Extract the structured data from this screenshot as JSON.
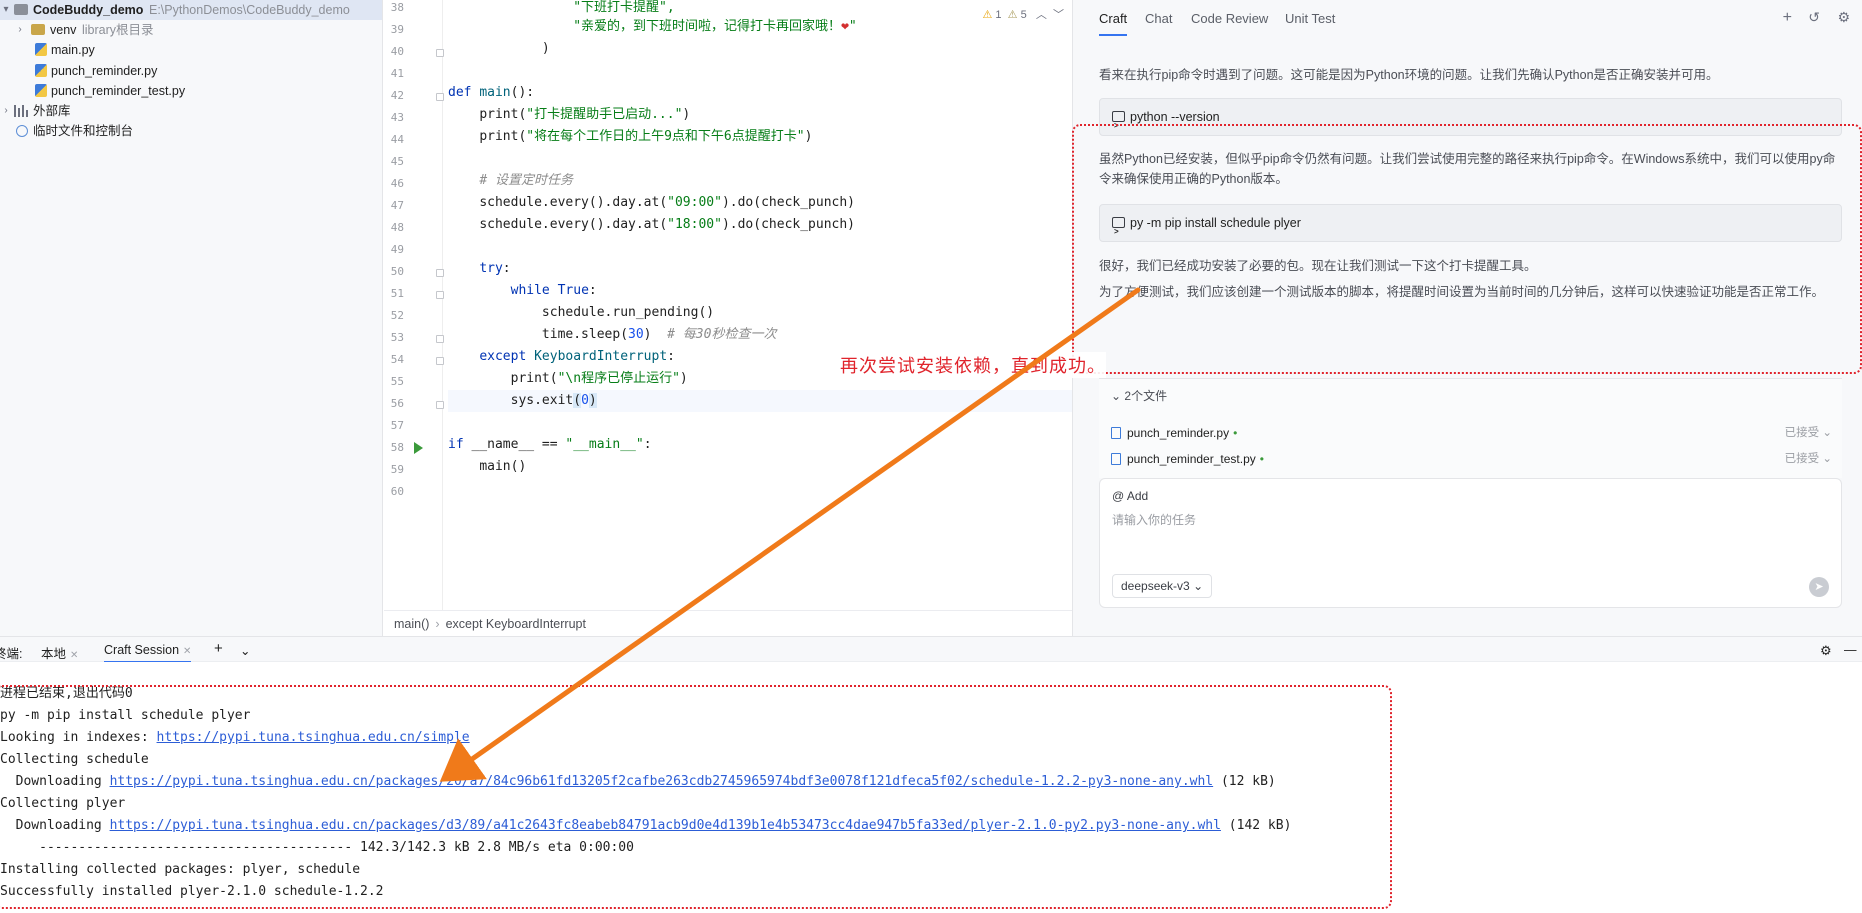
{
  "project_tree": {
    "root_name": "CodeBuddy_demo",
    "root_path": "E:\\PythonDemos\\CodeBuddy_demo",
    "venv_name": "venv",
    "venv_note": "library根目录",
    "files": [
      "main.py",
      "punch_reminder.py",
      "punch_reminder_test.py"
    ],
    "external_libs": "外部库",
    "scratches": "临时文件和控制台"
  },
  "editor": {
    "inspections": {
      "warnings": "1",
      "weak_warnings": "5"
    },
    "lines": [
      {
        "n": "38"
      },
      {
        "n": "39"
      },
      {
        "n": "40"
      },
      {
        "n": "41"
      },
      {
        "n": "42"
      },
      {
        "n": "43"
      },
      {
        "n": "44"
      },
      {
        "n": "45"
      },
      {
        "n": "46"
      },
      {
        "n": "47"
      },
      {
        "n": "48"
      },
      {
        "n": "49"
      },
      {
        "n": "50"
      },
      {
        "n": "51"
      },
      {
        "n": "52"
      },
      {
        "n": "53"
      },
      {
        "n": "54"
      },
      {
        "n": "55"
      },
      {
        "n": "56"
      },
      {
        "n": "57"
      },
      {
        "n": "58"
      },
      {
        "n": "59"
      },
      {
        "n": "60"
      }
    ],
    "code": {
      "l38": "\"下班打卡提醒\",",
      "l39": "\"亲爱的，到下班时间啦，记得打卡再回家哦！",
      "l39_heart": "❤",
      "l39_end": "\"",
      "l40": ")",
      "l42_kw": "def",
      "l42_fn": "main",
      "l42_rest": "():",
      "l43_a": "print(",
      "l43_s": "\"打卡提醒助手已启动...\"",
      "l43_b": ")",
      "l44_a": "print(",
      "l44_s": "\"将在每个工作日的上午9点和下午6点提醒打卡\"",
      "l44_b": ")",
      "l46": "# 设置定时任务",
      "l47_a": "schedule.every().day.at(",
      "l47_s": "\"09:00\"",
      "l47_b": ").do(check_punch)",
      "l48_a": "schedule.every().day.at(",
      "l48_s": "\"18:00\"",
      "l48_b": ").do(check_punch)",
      "l50_kw": "try",
      "l50_rest": ":",
      "l51_kw": "while True",
      "l51_rest": ":",
      "l52": "schedule.run_pending()",
      "l53_a": "time.sleep(",
      "l53_n": "30",
      "l53_b": ")  ",
      "l53_cm": "# 每30秒检查一次",
      "l54_kw": "except",
      "l54_cls": "KeyboardInterrupt",
      "l54_rest": ":",
      "l55_a": "print(",
      "l55_s": "\"\\n程序已停止运行\"",
      "l55_b": ")",
      "l56_a": "sys.exit",
      "l56_p1": "(",
      "l56_n": "0",
      "l56_p2": ")",
      "l58_kw": "if",
      "l58_mid": " __name__ == ",
      "l58_s": "\"__main__\"",
      "l58_rest": ":",
      "l59": "main()"
    },
    "breadcrumb": [
      "main()",
      "except KeyboardInterrupt"
    ]
  },
  "craft": {
    "tabs": [
      "Craft",
      "Chat",
      "Code Review",
      "Unit Test"
    ],
    "msg1": "看来在执行pip命令时遇到了问题。这可能是因为Python环境的问题。让我们先确认Python是否正确安装并可用。",
    "cmd1": "python --version",
    "msg2": "虽然Python已经安装，但似乎pip命令仍然有问题。让我们尝试使用完整的路径来执行pip命令。在Windows系统中，我们可以使用py命令来确保使用正确的Python版本。",
    "cmd2": "py -m pip install schedule plyer",
    "msg3": "很好，我们已经成功安装了必要的包。现在让我们测试一下这个打卡提醒工具。",
    "msg4": "为了方便测试，我们应该创建一个测试版本的脚本，将提醒时间设置为当前时间的几分钟后，这样可以快速验证功能是否正常工作。",
    "files_header": "2个文件",
    "files": [
      {
        "name": "punch_reminder.py",
        "status": "已接受"
      },
      {
        "name": "punch_reminder_test.py",
        "status": "已接受"
      }
    ],
    "add_label": "@ Add",
    "input_placeholder": "请输入你的任务",
    "model": "deepseek-v3"
  },
  "terminal": {
    "label": "终端:",
    "tabs": [
      "本地",
      "Craft Session"
    ],
    "lines": [
      "进程已结束,退出代码0",
      "py -m pip install schedule plyer",
      "Looking in indexes: ",
      "Collecting schedule",
      "  Downloading ",
      "Collecting plyer",
      "  Downloading ",
      "     ---------------------------------------- 142.3/142.3 kB 2.8 MB/s eta 0:00:00",
      "Installing collected packages: plyer, schedule",
      "Successfully installed plyer-2.1.0 schedule-1.2.2"
    ],
    "index_url": "https://pypi.tuna.tsinghua.edu.cn/simple",
    "schedule_url": "https://pypi.tuna.tsinghua.edu.cn/packages/20/a7/84c96b61fd13205f2cafbe263cdb2745965974bdf3e0078f121dfeca5f02/schedule-1.2.2-py3-none-any.whl",
    "schedule_size": " (12 kB)",
    "plyer_url": "https://pypi.tuna.tsinghua.edu.cn/packages/d3/89/a41c2643fc8eabeb84791acb9d0e4d139b1e4b53473cc4dae947b5fa33ed/plyer-2.1.0-py2.py3-none-any.whl",
    "plyer_size": " (142 kB)"
  },
  "annotation": {
    "text": "再次尝试安装依赖，直到成功。",
    "color": "#e0242c",
    "arrow_color": "#f07a1a"
  }
}
